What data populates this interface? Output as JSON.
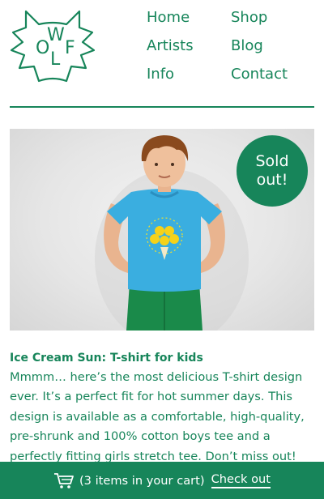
{
  "brand": {
    "logo_letters": [
      "O",
      "W",
      "L",
      "F"
    ],
    "color": "#17855a"
  },
  "nav": {
    "items": [
      {
        "label": "Home"
      },
      {
        "label": "Shop"
      },
      {
        "label": "Artists"
      },
      {
        "label": "Blog"
      },
      {
        "label": "Info"
      },
      {
        "label": "Contact"
      }
    ]
  },
  "product": {
    "badge_line1": "Sold",
    "badge_line2": "out!",
    "title": "Ice Cream Sun: T-shirt for kids",
    "description": "Mmmm… here’s the most delicious T-shirt design ever. It’s a perfect fit for hot summer days. This design is available as a comfortable, high-quality, pre-shrunk and 100% cotton boys tee and a perfectly fitting girls stretch tee. Don’t miss out!"
  },
  "cart": {
    "icon": "cart-icon",
    "status": "(3 items in your cart)",
    "checkout_label": "Check out"
  },
  "colors": {
    "accent": "#17855a",
    "shirt": "#3aaee0",
    "pants": "#1a8a4a"
  }
}
